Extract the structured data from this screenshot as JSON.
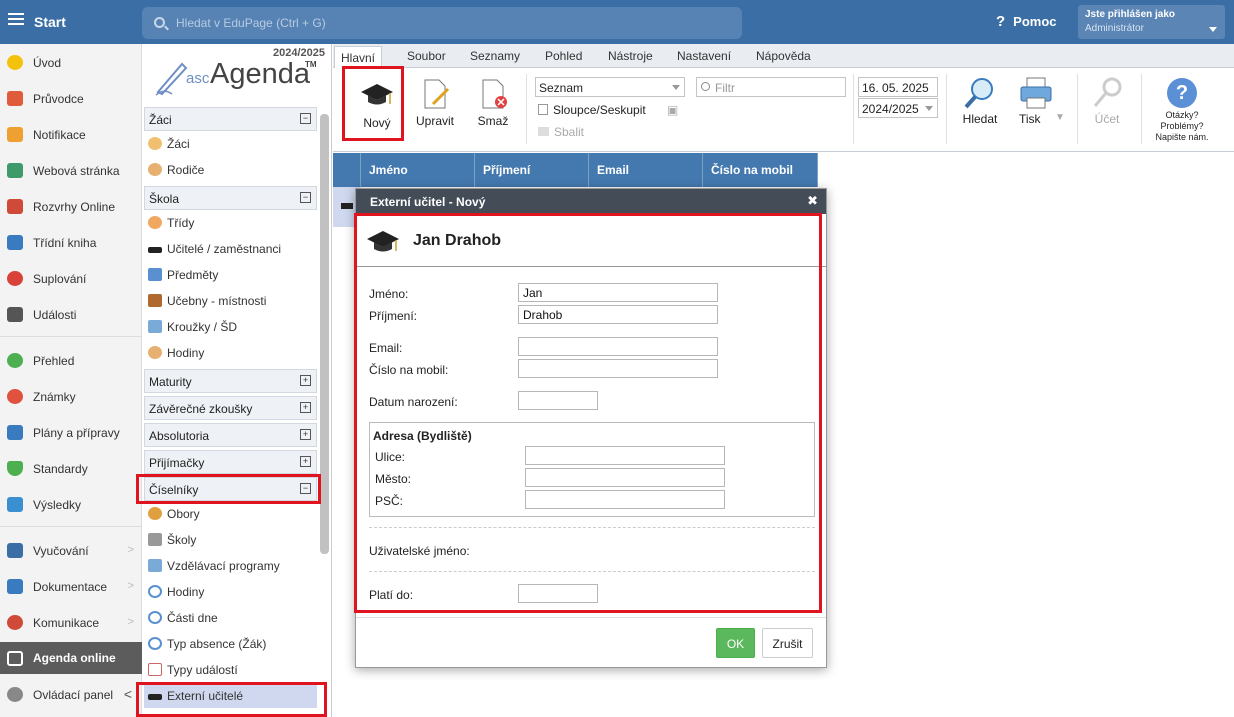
{
  "topbar": {
    "start": "Start",
    "search_placeholder": "Hledat v EduPage (Ctrl + G)",
    "help_label": "Pomoc",
    "user_line1": "Jste přihlášen jako",
    "user_line2": "Administrátor"
  },
  "leftnav": {
    "items": [
      "Úvod",
      "Průvodce",
      "Notifikace",
      "Webová stránka",
      "Rozvrhy Online",
      "Třídní kniha",
      "Suplování",
      "Události",
      "Přehled",
      "Známky",
      "Plány a přípravy",
      "Standardy",
      "Výsledky",
      "Vyučování",
      "Dokumentace",
      "Komunikace",
      "Agenda online",
      "Ovládací panel"
    ]
  },
  "agenda": {
    "year": "2024/2025",
    "logo_asc": "asc",
    "logo_agenda": "Agenda",
    "logo_tm": "TM",
    "sections": {
      "zaci": "Žáci",
      "skola": "Škola",
      "maturity": "Maturity",
      "zaverecne": "Závěrečné zkoušky",
      "absolutoria": "Absolutoria",
      "prijimacky": "Přijímačky",
      "ciselniky": "Číselníky"
    },
    "zaci_items": [
      "Žáci",
      "Rodiče"
    ],
    "skola_items": [
      "Třídy",
      "Učitelé / zaměstnanci",
      "Předměty",
      "Učebny - místnosti",
      "Kroužky / ŠD",
      "Hodiny"
    ],
    "ciselniky_items": [
      "Obory",
      "Školy",
      "Vzdělávací programy",
      "Hodiny",
      "Části dne",
      "Typ absence (Žák)",
      "Typy událostí",
      "Externí učitelé"
    ]
  },
  "tabs": [
    "Hlavní",
    "Soubor",
    "Seznamy",
    "Pohled",
    "Nástroje",
    "Nastavení",
    "Nápověda"
  ],
  "ribbon": {
    "novy": "Nový",
    "upravit": "Upravit",
    "smaz": "Smaž",
    "seznam": "Seznam",
    "sloupce": "Sloupce/Seskupit",
    "sbalit": "Sbalit",
    "filtr": "Filtr",
    "date": "16. 05. 2025",
    "year": "2024/2025",
    "hledat": "Hledat",
    "tisk": "Tisk",
    "ucet": "Účet",
    "help1": "Otázky?",
    "help2": "Problémy?",
    "help3": "Napište nám."
  },
  "grid": {
    "columns": [
      "Jméno",
      "Příjmení",
      "Email",
      "Číslo na mobil"
    ]
  },
  "modal": {
    "title": "Externí učitel - Nový",
    "name_heading": "Jan Drahob",
    "labels": {
      "jmeno": "Jméno:",
      "prijmeni": "Příjmení:",
      "email": "Email:",
      "mobil": "Číslo na mobil:",
      "narozeni": "Datum narození:",
      "adresa": "Adresa (Bydliště)",
      "ulice": "Ulice:",
      "mesto": "Město:",
      "psc": "PSČ:",
      "uzivatel": "Uživatelské jméno:",
      "plati": "Platí do:"
    },
    "values": {
      "jmeno": "Jan",
      "prijmeni": "Drahob",
      "email": "",
      "mobil": "",
      "narozeni": "",
      "ulice": "",
      "mesto": "",
      "psc": "",
      "plati": ""
    },
    "ok": "OK",
    "cancel": "Zrušit"
  }
}
